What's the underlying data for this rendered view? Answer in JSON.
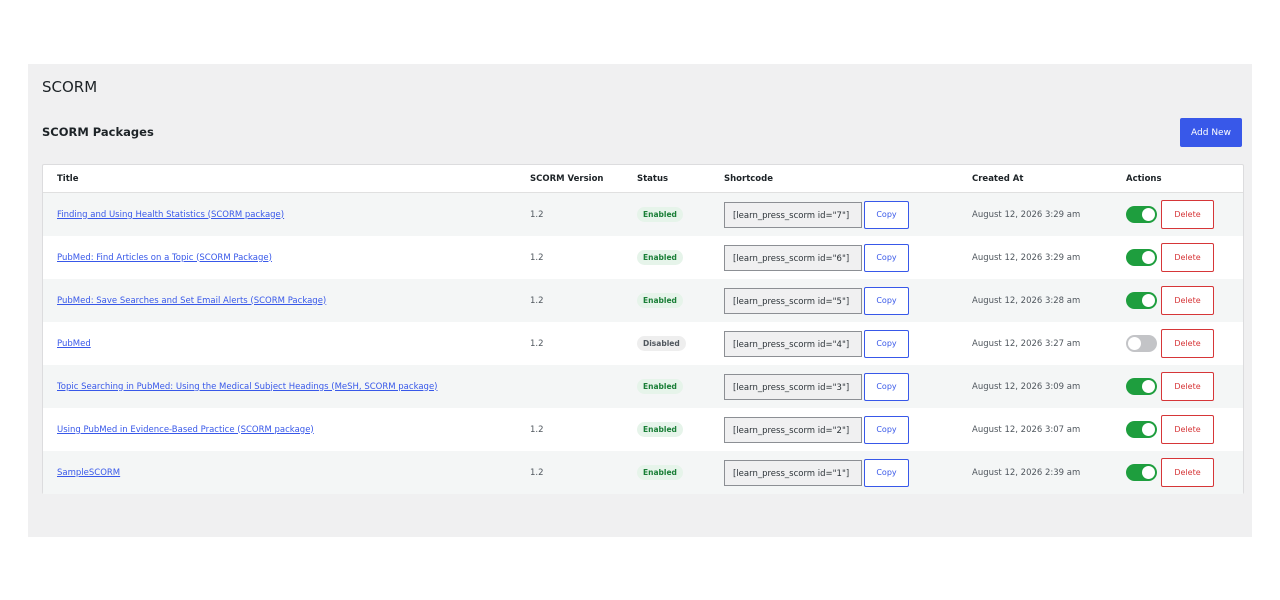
{
  "page": {
    "title": "SCORM"
  },
  "section": {
    "title": "SCORM Packages",
    "add_new_label": "Add New"
  },
  "table": {
    "headers": {
      "title": "Title",
      "version": "SCORM Version",
      "status": "Status",
      "shortcode": "Shortcode",
      "created": "Created At",
      "actions": "Actions"
    },
    "copy_label": "Copy",
    "delete_label": "Delete",
    "rows": [
      {
        "title": "Finding and Using Health Statistics (SCORM package)",
        "version": "1.2",
        "status": "Enabled",
        "shortcode": "[learn_press_scorm id=\"7\"]",
        "created": "August 12, 2026 3:29 am",
        "enabled": true
      },
      {
        "title": "PubMed: Find Articles on a Topic (SCORM Package)",
        "version": "1.2",
        "status": "Enabled",
        "shortcode": "[learn_press_scorm id=\"6\"]",
        "created": "August 12, 2026 3:29 am",
        "enabled": true
      },
      {
        "title": "PubMed: Save Searches and Set Email Alerts (SCORM Package)",
        "version": "1.2",
        "status": "Enabled",
        "shortcode": "[learn_press_scorm id=\"5\"]",
        "created": "August 12, 2026 3:28 am",
        "enabled": true
      },
      {
        "title": "PubMed",
        "version": "1.2",
        "status": "Disabled",
        "shortcode": "[learn_press_scorm id=\"4\"]",
        "created": "August 12, 2026 3:27 am",
        "enabled": false
      },
      {
        "title": "Topic Searching in PubMed: Using the Medical Subject Headings (MeSH, SCORM package)",
        "version": "",
        "status": "Enabled",
        "shortcode": "[learn_press_scorm id=\"3\"]",
        "created": "August 12, 2026 3:09 am",
        "enabled": true
      },
      {
        "title": "Using PubMed in Evidence-Based Practice (SCORM package)",
        "version": "1.2",
        "status": "Enabled",
        "shortcode": "[learn_press_scorm id=\"2\"]",
        "created": "August 12, 2026 3:07 am",
        "enabled": true
      },
      {
        "title": "SampleSCORM",
        "version": "1.2",
        "status": "Enabled",
        "shortcode": "[learn_press_scorm id=\"1\"]",
        "created": "August 12, 2026 2:39 am",
        "enabled": true
      }
    ]
  },
  "colors": {
    "accent": "#3858e9",
    "toggle_on": "#1e9e3e",
    "delete": "#d63638"
  }
}
